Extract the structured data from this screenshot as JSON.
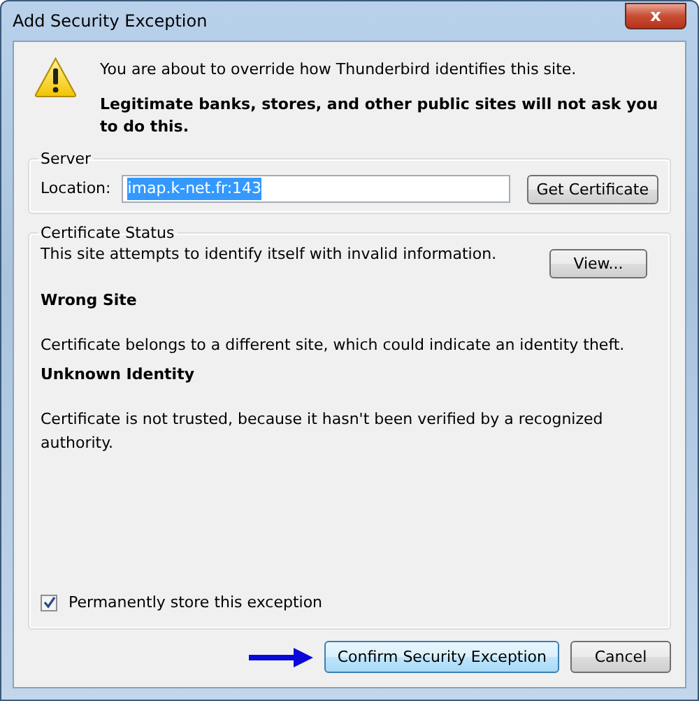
{
  "window": {
    "title": "Add Security Exception",
    "close_label": "x"
  },
  "warning": {
    "line_1": "You are about to override how Thunderbird identifies this site.",
    "line_2": "Legitimate banks, stores, and other public sites will not ask you to do this."
  },
  "server": {
    "legend": "Server",
    "location_label": "Location:",
    "location_value": "imap.k-net.fr:143",
    "text_selected": true,
    "get_certificate_button": "Get Certificate"
  },
  "certificate_status": {
    "legend": "Certificate Status",
    "summary": "This site attempts to identify itself with invalid information.",
    "view_button": "View...",
    "problems": [
      {
        "title": "Wrong Site",
        "description": "Certificate belongs to a different site, which could indicate an identity theft."
      },
      {
        "title": "Unknown Identity",
        "description": "Certificate is not trusted, because it hasn't been verified by a recognized authority."
      }
    ],
    "permanent_checkbox": {
      "label": "Permanently store this exception",
      "checked": true
    }
  },
  "buttons": [
    {
      "label": "Confirm Security Exception",
      "default": true
    },
    {
      "label": "Cancel",
      "default": false
    }
  ]
}
